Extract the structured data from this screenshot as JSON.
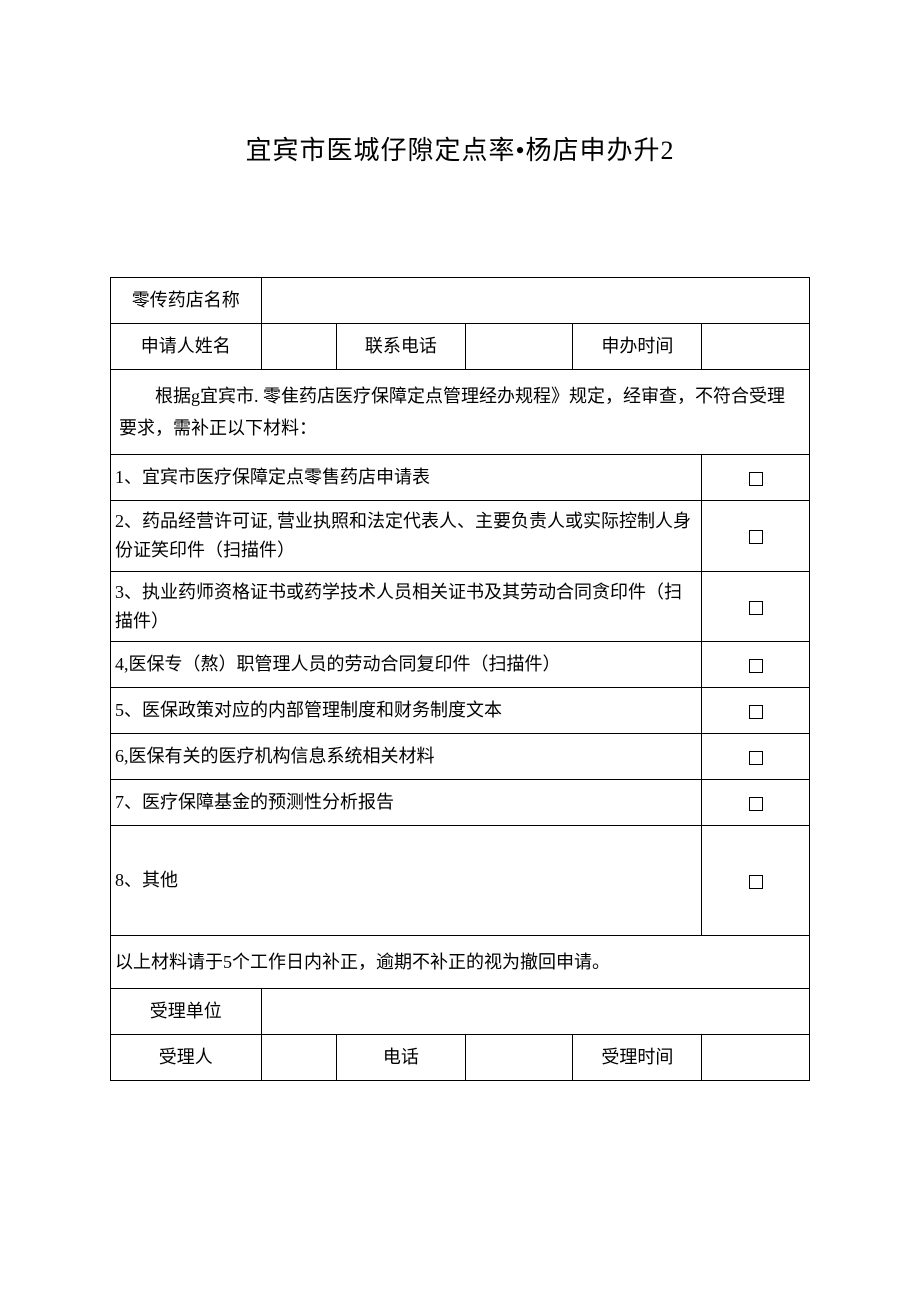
{
  "title": "宜宾市医城仔隙定点率•杨店申办升2",
  "row1": {
    "label": "零传药店名称"
  },
  "row2": {
    "applicantLabel": "申请人姓名",
    "phoneLabel": "联系电话",
    "timeLabel": "申办时间"
  },
  "intro": "根据g宜宾市. 零隹药店医疗保障定点管理经办规程》规定，经审查，不符合受理要求，需补正以下材料：",
  "items": {
    "i1": "1、宜宾市医疗保障定点零售药店申请表",
    "i2": "2、药品经营许可证, 营业执照和法定代表人、主要负责人或实际控制人身份证笑印件（扫描件）",
    "i3": "3、执业药师资格证书或药学技术人员相关证书及其劳动合同贪印件（扫描件）",
    "i4": "4,医保专（熬）职管理人员的劳动合同复印件（扫描件）",
    "i5": "5、医保政策对应的内部管理制度和财务制度文本",
    "i6": "6,医保有关的医疗机构信息系统相关材料",
    "i7": "7、医疗保障基金的预测性分析报告",
    "i8": "8、其他"
  },
  "footnote": "以上材料请于5个工作日内补正，逾期不补正的视为撤回申请。",
  "row3": {
    "label": "受理单位"
  },
  "row4": {
    "personLabel": "受理人",
    "phoneLabel": "电话",
    "timeLabel": "受理时间"
  }
}
